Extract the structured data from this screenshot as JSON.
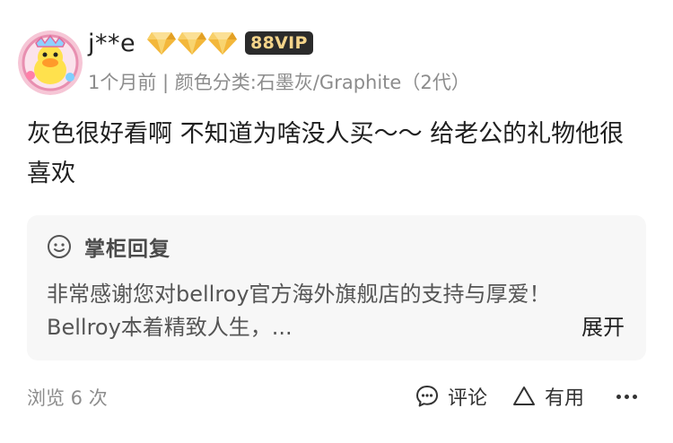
{
  "review": {
    "username": "j**e",
    "vip_label": "88VIP",
    "level_icon": "diamond-icon",
    "meta": "1个月前 | 颜色分类:石墨灰/Graphite（2代）",
    "text": "灰色很好看啊 不知道为啥没人买～～ 给老公的礼物他很喜欢"
  },
  "reply": {
    "icon": "smile-icon",
    "title": "掌柜回复",
    "body": "非常感谢您对bellroy官方海外旗舰店的支持与厚爱！Bellroy本着精致人生，...",
    "expand_label": "展开"
  },
  "footer": {
    "views": "浏览 6 次",
    "comment_label": "评论",
    "useful_label": "有用"
  },
  "colors": {
    "vip_bg": "#2b2b2b",
    "vip_text": "#f4d48a",
    "diamond": "#f3b73a",
    "reply_bg": "#f7f7f7",
    "meta_text": "#8c8c8c"
  }
}
